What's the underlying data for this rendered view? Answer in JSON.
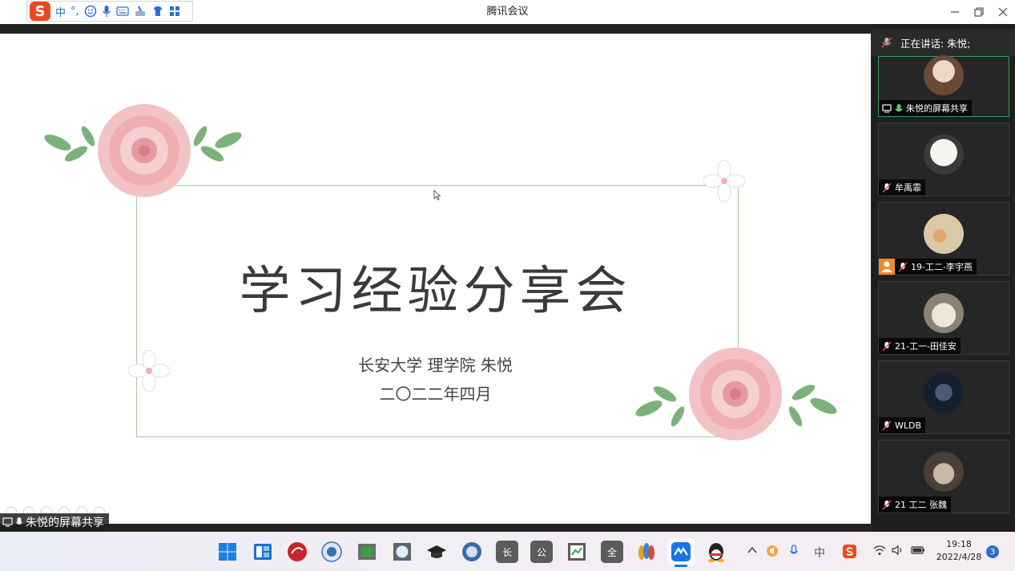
{
  "window": {
    "title": "腾讯会议"
  },
  "ime": {
    "logo": "S",
    "mode": "中",
    "punct": "°,"
  },
  "slide": {
    "title": "学习经验分享会",
    "subtitle1": "长安大学 理学院 朱悦",
    "subtitle2": "二〇二二年四月"
  },
  "share": {
    "label": "朱悦的屏幕共享"
  },
  "sidebar": {
    "speaking": "正在讲话: 朱悦;",
    "participants": [
      {
        "name": "朱悦的屏幕共享",
        "mic": "on",
        "sharing": true,
        "color": "#c89a6a"
      },
      {
        "name": "牟禹霏",
        "mic": "muted",
        "color": "#d8d8d0"
      },
      {
        "name": "19-工二-李宇燕",
        "mic": "muted",
        "host_badge": true,
        "color": "#d9c9a8"
      },
      {
        "name": "21-工一-田佳安",
        "mic": "muted",
        "color": "#c8c0b0"
      },
      {
        "name": "WLDB",
        "mic": "muted",
        "color": "#2a3a55"
      },
      {
        "name": "21 工二  张魏",
        "mic": "muted",
        "color": "#8a7a70"
      }
    ]
  },
  "taskbar": {
    "apps": [
      "start",
      "widgets",
      "chaoxing",
      "school1",
      "green-app",
      "school2",
      "grad-cap",
      "school3",
      "长",
      "公",
      "chart-app",
      "全",
      "feather-app",
      "tencent-meeting",
      "qq"
    ],
    "label_chang": "长",
    "label_gong": "公",
    "label_quan": "全",
    "ime_tray": "中",
    "time": "19:18",
    "date": "2022/4/28",
    "notifications": "3"
  },
  "colors": {
    "accent": "#2ea05a",
    "brand_ime": "#e84a1f",
    "meeting_blue": "#1a73e8"
  }
}
